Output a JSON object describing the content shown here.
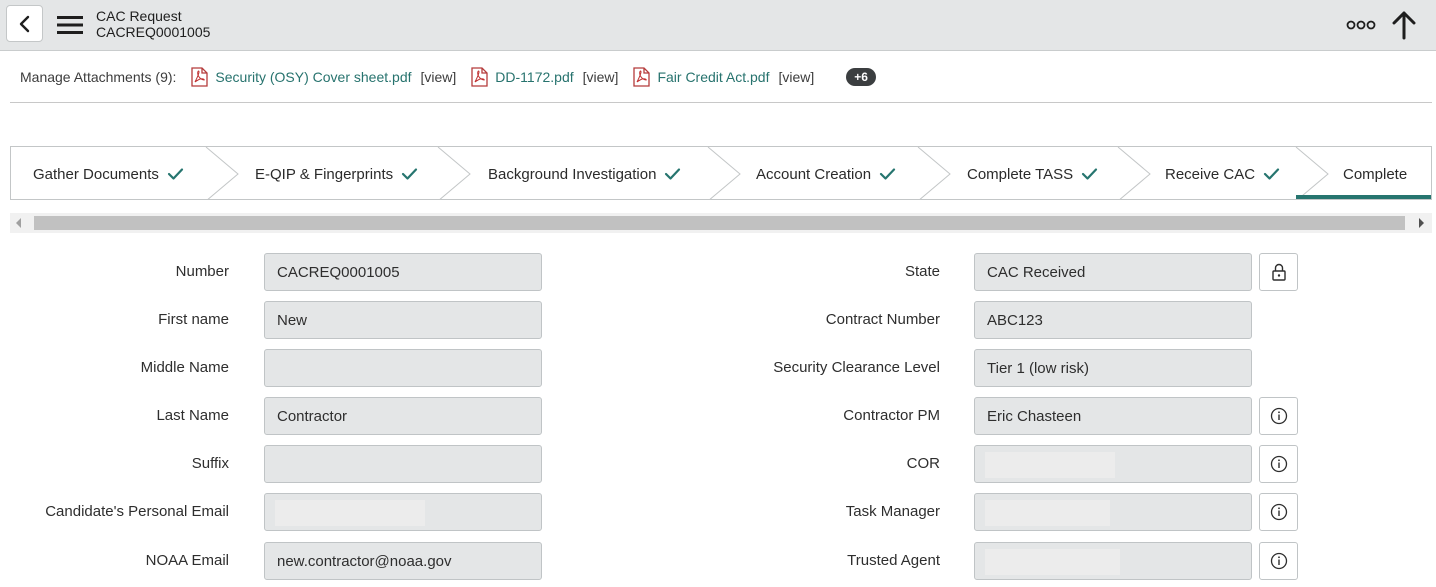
{
  "header": {
    "title": "CAC Request",
    "subtitle": "CACREQ0001005",
    "icons": {
      "back": "chevron-left-icon",
      "menu": "hamburger-menu-icon",
      "more": "more-options-icon",
      "up": "arrow-up-icon"
    }
  },
  "attachments": {
    "label": "Manage Attachments (9):",
    "items": [
      {
        "name": "Security (OSY) Cover sheet.pdf",
        "view": "[view]"
      },
      {
        "name": "DD-1172.pdf",
        "view": "[view]"
      },
      {
        "name": "Fair Credit Act.pdf",
        "view": "[view]"
      }
    ],
    "more": "+6"
  },
  "stages": [
    {
      "label": "Gather Documents",
      "complete": true
    },
    {
      "label": "E-QIP & Fingerprints",
      "complete": true
    },
    {
      "label": "Background Investigation",
      "complete": true
    },
    {
      "label": "Account Creation",
      "complete": true
    },
    {
      "label": "Complete TASS",
      "complete": true
    },
    {
      "label": "Receive CAC",
      "complete": true
    },
    {
      "label": "Complete",
      "complete": false,
      "active": true
    }
  ],
  "form": {
    "left": [
      {
        "label": "Number",
        "value": "CACREQ0001005"
      },
      {
        "label": "First name",
        "value": "New"
      },
      {
        "label": "Middle Name",
        "value": ""
      },
      {
        "label": "Last Name",
        "value": "Contractor"
      },
      {
        "label": "Suffix",
        "value": ""
      },
      {
        "label": "Candidate's Personal Email",
        "value": ""
      },
      {
        "label": "NOAA Email",
        "value": "new.contractor@noaa.gov"
      }
    ],
    "right": [
      {
        "label": "State",
        "value": "CAC Received"
      },
      {
        "label": "Contract Number",
        "value": "ABC123"
      },
      {
        "label": "Security Clearance Level",
        "value": "Tier 1 (low risk)"
      },
      {
        "label": "Contractor PM",
        "value": "Eric Chasteen"
      },
      {
        "label": "COR",
        "value": ""
      },
      {
        "label": "Task Manager",
        "value": ""
      },
      {
        "label": "Trusted Agent",
        "value": ""
      }
    ]
  },
  "colors": {
    "accent": "#26756f",
    "link": "#27736e",
    "field_bg": "#e4e6e7",
    "header_bg": "#e4e6e7"
  }
}
